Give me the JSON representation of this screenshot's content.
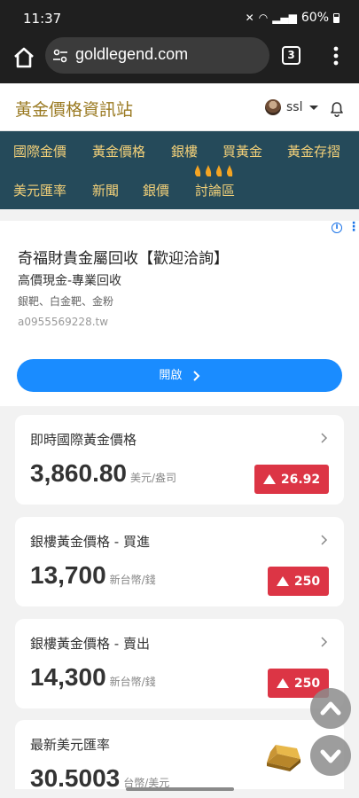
{
  "status": {
    "time": "11:37",
    "battery": "60%"
  },
  "browser": {
    "url": "goldlegend.com",
    "tab_count": "3"
  },
  "site": {
    "logo": "黃金價格資訊站",
    "username": "ssl"
  },
  "nav": {
    "row1": [
      "國際金價",
      "黃金價格",
      "銀樓",
      "買黃金",
      "黃金存摺"
    ],
    "row2": [
      "美元匯率",
      "新聞",
      "銀價",
      "討論區"
    ]
  },
  "ad": {
    "title": "奇福財貴金屬回收【歡迎洽詢】",
    "subtitle": "高價現金-專業回收",
    "detail": "銀靶、白金靶、金粉",
    "phone": "a0955569228.tw",
    "cta": "開啟"
  },
  "cards": [
    {
      "title": "即時國際黃金價格",
      "price": "3,860.80",
      "unit": "美元/盎司",
      "change": "26.92"
    },
    {
      "title": "銀樓黃金價格 - 買進",
      "price": "13,700",
      "unit": "新台幣/錢",
      "change": "250"
    },
    {
      "title": "銀樓黃金價格 - 賣出",
      "price": "14,300",
      "unit": "新台幣/錢",
      "change": "250"
    },
    {
      "title": "最新美元匯率",
      "price": "30.5003",
      "unit": "台幣/美元"
    }
  ],
  "colors": {
    "nav_bg": "#254a5a",
    "nav_text": "#f2d079",
    "logo": "#9a7a22",
    "up_badge": "#dc3545",
    "cta": "#1a8cff"
  },
  "icons": [
    "home-icon",
    "site-settings-icon",
    "overflow-menu-icon",
    "bell-icon",
    "chevron-right-icon",
    "up-triangle-icon",
    "gold-bar-icon",
    "scroll-up-icon",
    "scroll-down-icon",
    "fire-icon"
  ]
}
